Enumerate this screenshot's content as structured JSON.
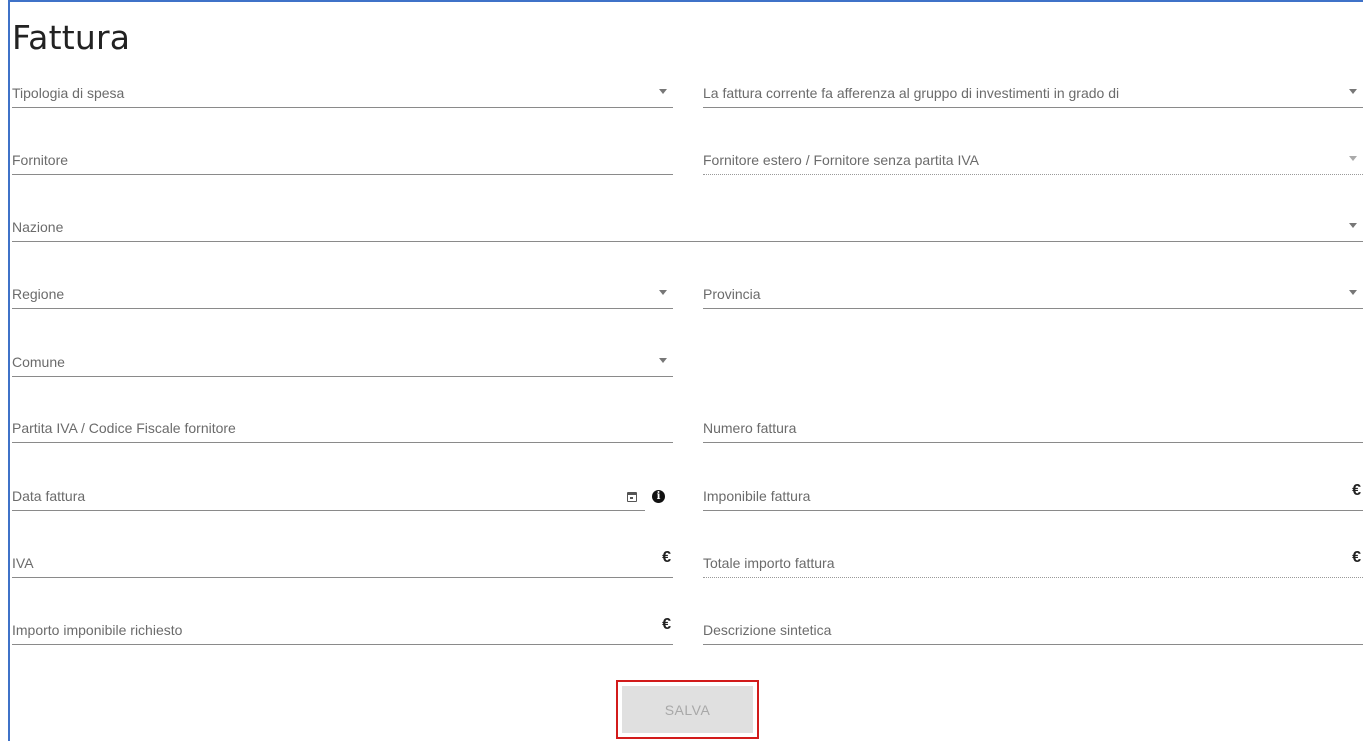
{
  "form": {
    "title": "Fattura",
    "fields": {
      "tipologia": "Tipologia di spesa",
      "gruppo": "La fattura corrente fa afferenza al gruppo di investimenti in grado di",
      "fornitore": "Fornitore",
      "fornitore_estero": "Fornitore estero / Fornitore senza partita IVA",
      "nazione": "Nazione",
      "regione": "Regione",
      "provincia": "Provincia",
      "comune": "Comune",
      "partita_iva": "Partita IVA / Codice Fiscale fornitore",
      "numero_fattura": "Numero fattura",
      "data_fattura": "Data fattura",
      "imponibile": "Imponibile fattura",
      "iva": "IVA",
      "totale": "Totale importo fattura",
      "importo_richiesto": "Importo imponibile richiesto",
      "descrizione": "Descrizione sintetica"
    },
    "currency_symbol": "€",
    "info_symbol": "i",
    "save_label": "SALVA"
  },
  "colors": {
    "panel_border": "#3f72c8",
    "save_highlight": "#d21b1b",
    "button_disabled_bg": "#e0e0e0"
  },
  "icons": [
    "dropdown-caret-icon",
    "calendar-icon",
    "info-icon",
    "euro-icon"
  ]
}
